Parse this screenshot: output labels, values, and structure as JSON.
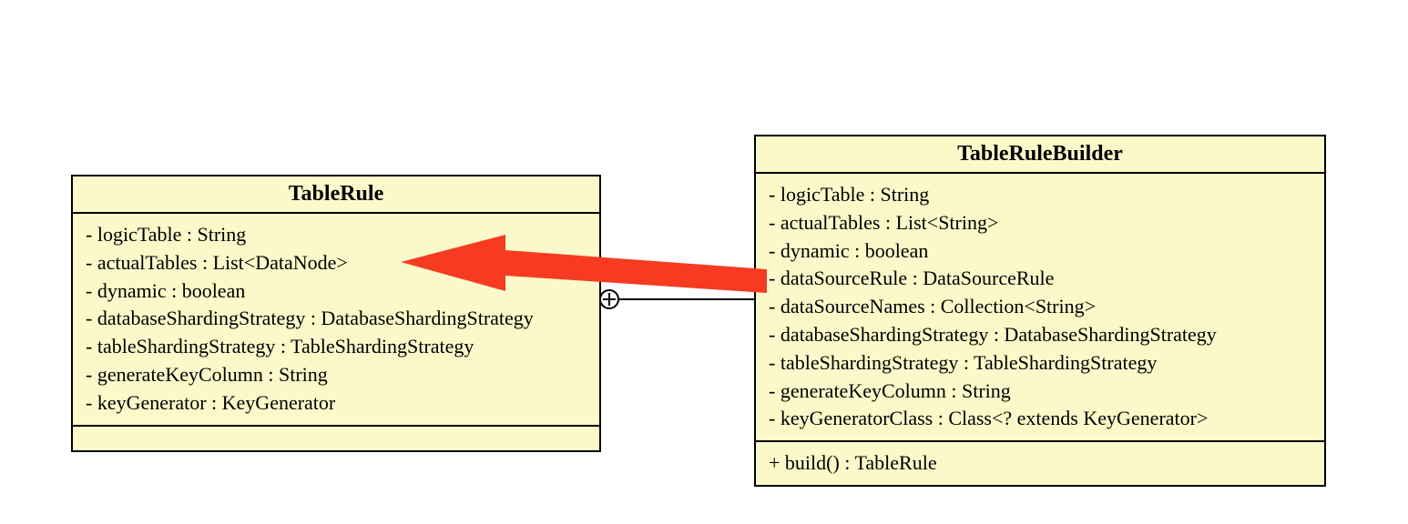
{
  "left": {
    "name": "TableRule",
    "attrs": [
      "- logicTable : String",
      "- actualTables : List<DataNode>",
      "- dynamic : boolean",
      "- databaseShardingStrategy : DatabaseShardingStrategy",
      "- tableShardingStrategy : TableShardingStrategy",
      "- generateKeyColumn : String",
      "- keyGenerator : KeyGenerator"
    ],
    "ops": []
  },
  "right": {
    "name": "TableRuleBuilder",
    "attrs": [
      "- logicTable : String",
      "- actualTables : List<String>",
      "- dynamic : boolean",
      "- dataSourceRule : DataSourceRule",
      "- dataSourceNames : Collection<String>",
      "- databaseShardingStrategy : DatabaseShardingStrategy",
      "- tableShardingStrategy : TableShardingStrategy",
      "- generateKeyColumn : String",
      "- keyGeneratorClass : Class<? extends KeyGenerator>"
    ],
    "ops": [
      "+ build() : TableRule"
    ]
  },
  "relation": {
    "type": "nesting-with-arrow",
    "from": "TableRuleBuilder",
    "to": "TableRule"
  }
}
